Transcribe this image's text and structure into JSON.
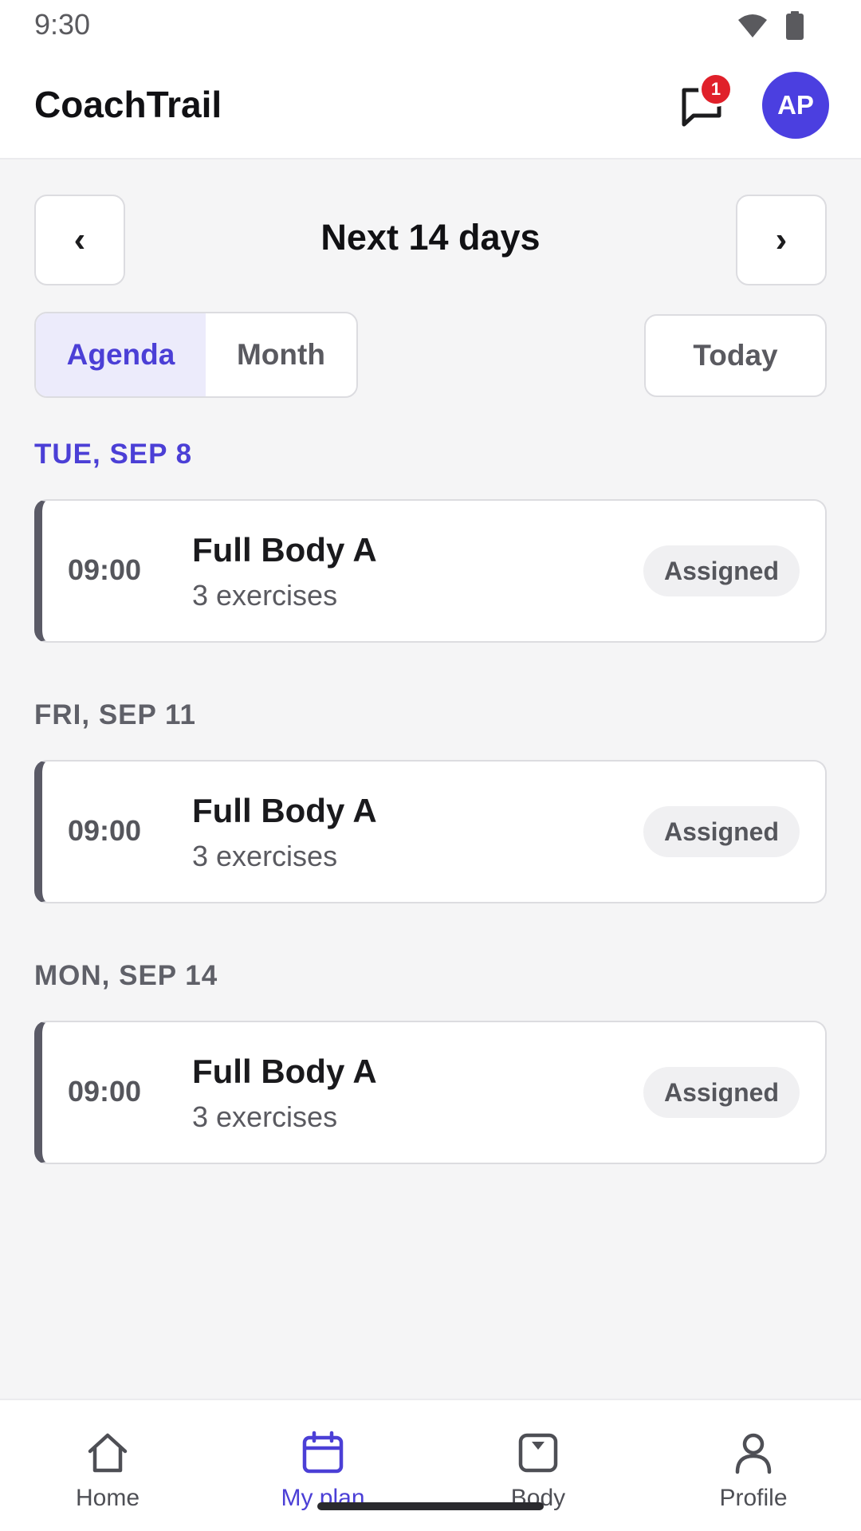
{
  "status_bar": {
    "time": "9:30",
    "icons": [
      "wifi-icon",
      "battery-icon"
    ]
  },
  "header": {
    "app_title": "CoachTrail",
    "messages_icon": "chat-bubble-icon",
    "unread_count": "1",
    "avatar_initials": "AP"
  },
  "range": {
    "prev_label": "‹",
    "title": "Next 14 days",
    "next_label": "›"
  },
  "view_toggle": {
    "agenda_label": "Agenda",
    "month_label": "Month",
    "selected": "Agenda"
  },
  "today_label": "Today",
  "agenda": [
    {
      "day": "TUE, SEP 8",
      "active": true,
      "time": "09:00",
      "title": "Full Body A",
      "subtitle": "3 exercises",
      "status": "Assigned"
    },
    {
      "day": "FRI, SEP 11",
      "active": false,
      "time": "09:00",
      "title": "Full Body A",
      "subtitle": "3 exercises",
      "status": "Assigned"
    },
    {
      "day": "MON, SEP 14",
      "active": false,
      "time": "09:00",
      "title": "Full Body A",
      "subtitle": "3 exercises",
      "status": "Assigned"
    }
  ],
  "bottom_nav": {
    "items": [
      {
        "label": "Home",
        "icon": "home-icon"
      },
      {
        "label": "My plan",
        "icon": "calendar-icon"
      },
      {
        "label": "Body",
        "icon": "scale-icon"
      },
      {
        "label": "Profile",
        "icon": "person-icon"
      }
    ],
    "active": "My plan"
  },
  "colors": {
    "accent": "#4b3fd6",
    "badge": "#e0202a",
    "avatar": "#4b3fe0"
  }
}
